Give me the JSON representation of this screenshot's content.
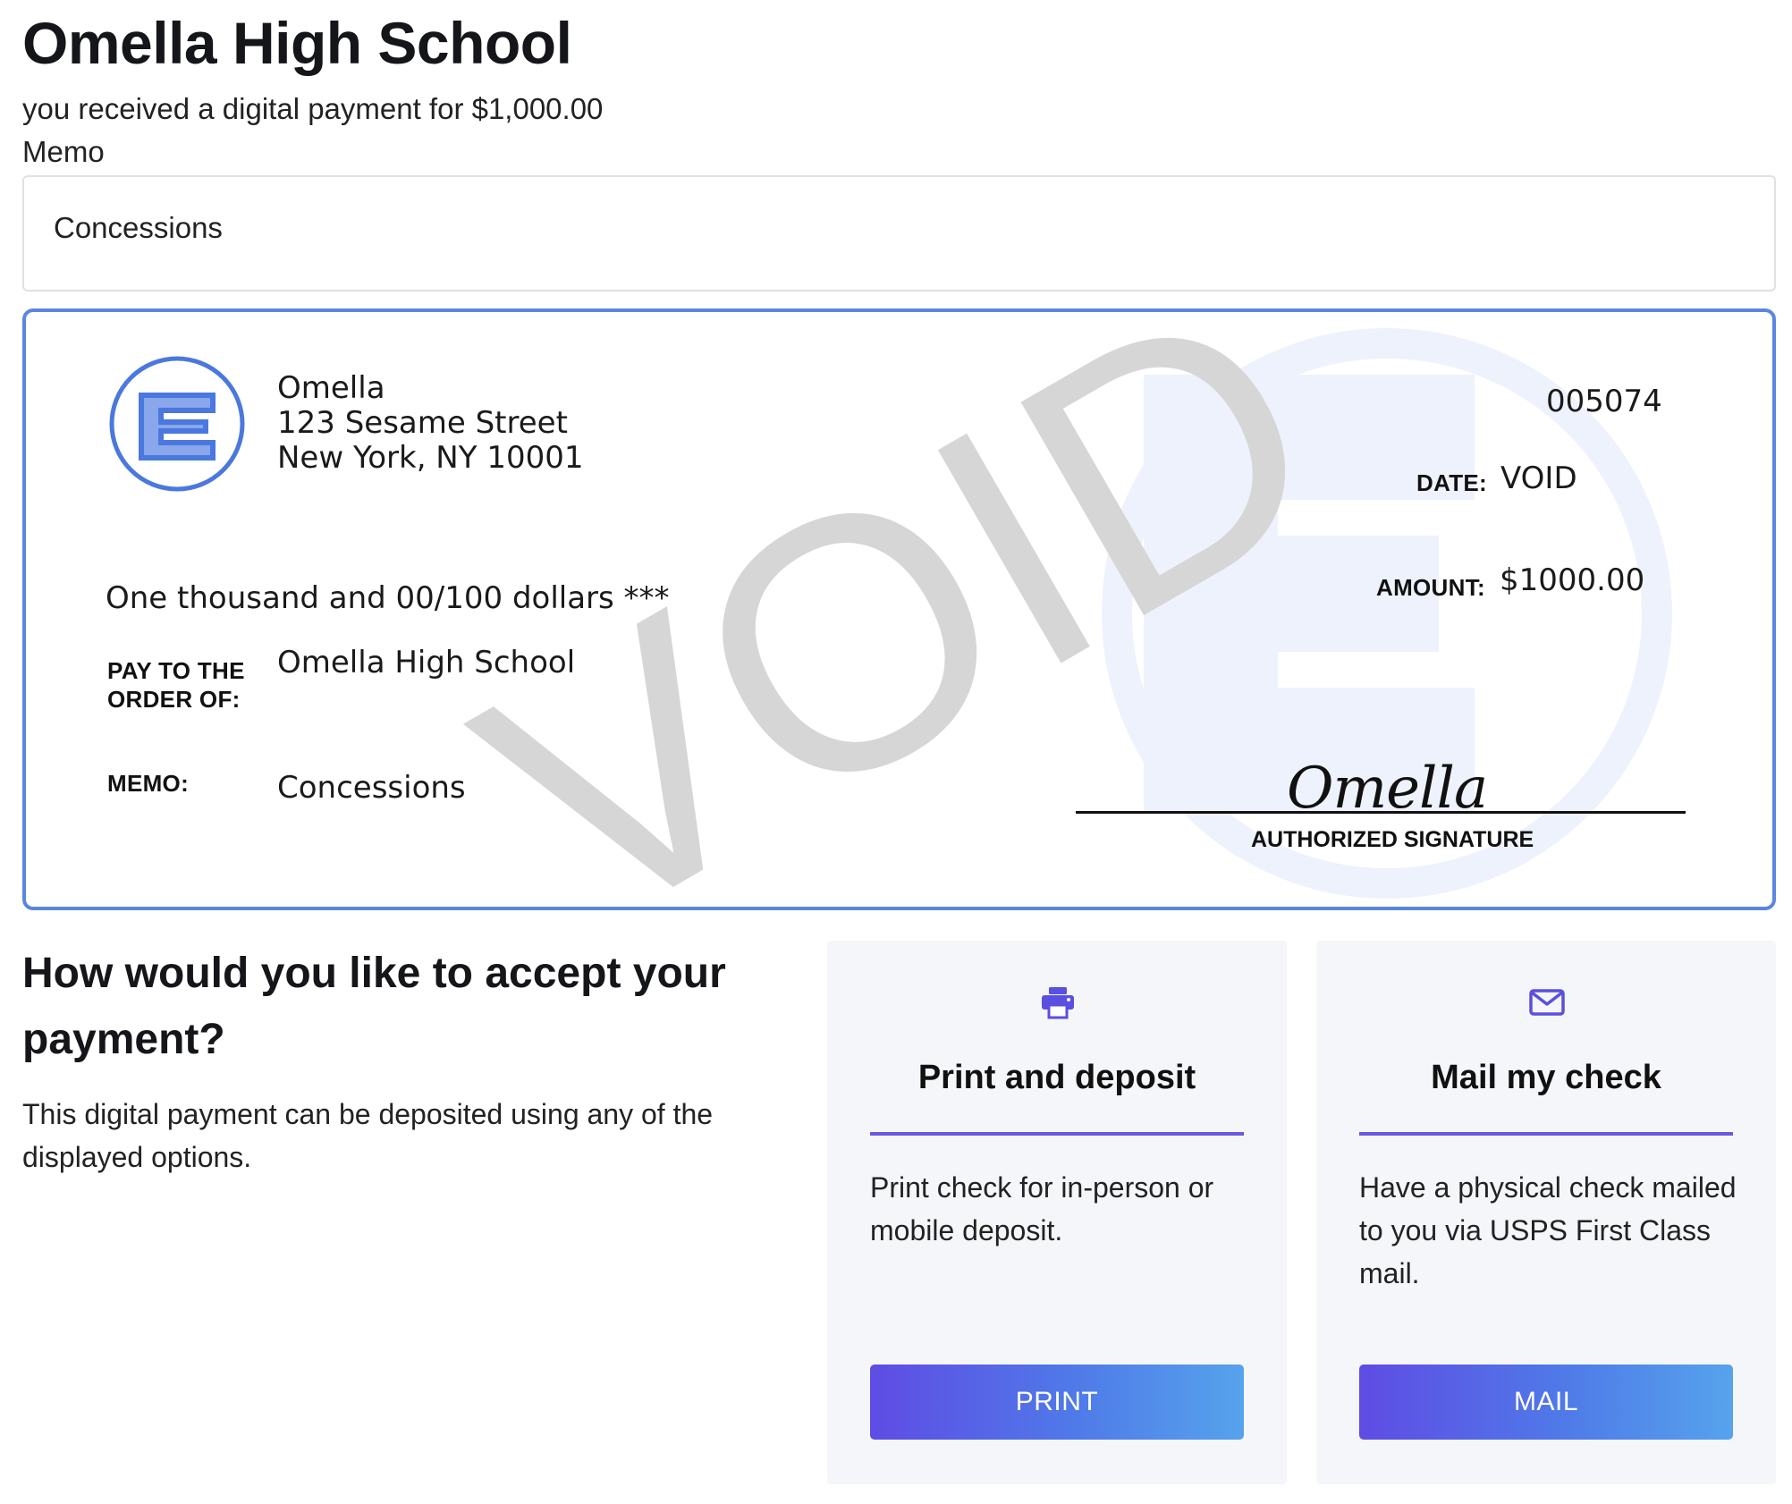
{
  "header": {
    "title": "Omella High School",
    "subtitle": "you received a digital payment for $1,000.00",
    "memo_label": "Memo",
    "memo_value": "Concessions"
  },
  "check": {
    "issuer_name": "Omella",
    "issuer_street": "123 Sesame Street",
    "issuer_city": "New York, NY 10001",
    "check_number": "005074",
    "date_label": "DATE:",
    "date_value": "VOID",
    "amount_label": "AMOUNT:",
    "amount_value": "$1000.00",
    "amount_words": "One thousand and 00/100 dollars ***",
    "pay_to_label_1": "PAY TO THE",
    "pay_to_label_2": "ORDER OF:",
    "payee": "Omella High School",
    "memo_label": "MEMO:",
    "memo_value": "Concessions",
    "watermark": "VOID",
    "signature_name": "Omella",
    "signature_label": "AUTHORIZED SIGNATURE",
    "logo_icon": "omella-e-logo-icon",
    "colors": {
      "border": "#5b86e0",
      "logo": "#4a78df",
      "watermark": "#d6d6d6"
    }
  },
  "accept": {
    "title": "How would you like to accept your payment?",
    "description": "This digital payment can be deposited using any of the displayed options."
  },
  "options": [
    {
      "icon": "printer-icon",
      "title": "Print and deposit",
      "description": "Print check for in-person or mobile deposit.",
      "button": "PRINT"
    },
    {
      "icon": "envelope-icon",
      "title": "Mail my check",
      "description": "Have a physical check mailed to you via USPS First Class mail.",
      "button": "MAIL"
    }
  ],
  "colors": {
    "accent": "#6a5ae0",
    "button_start": "#5f4ce4",
    "button_end": "#56a3ec",
    "card_bg": "#f5f6f9"
  }
}
